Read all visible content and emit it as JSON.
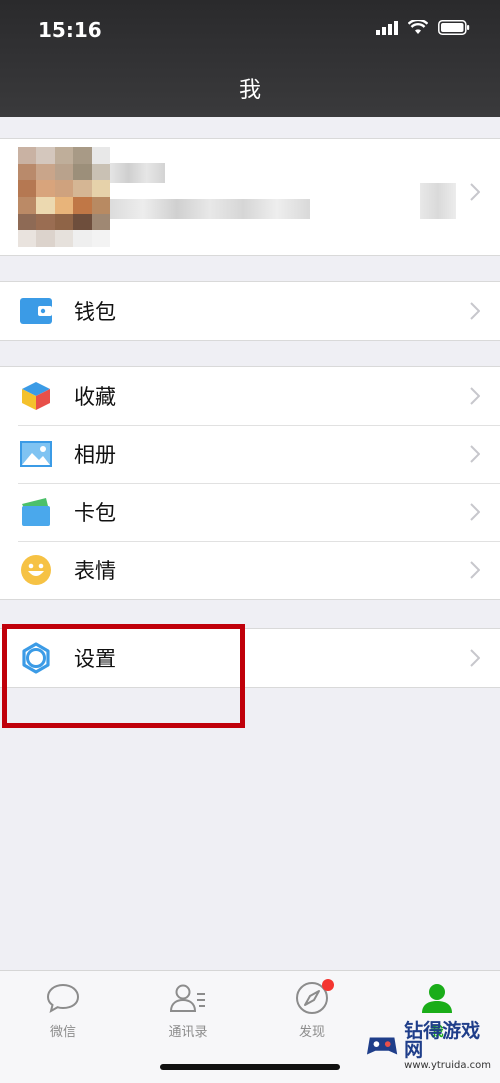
{
  "status_bar": {
    "time": "15:16"
  },
  "nav": {
    "title": "我"
  },
  "menu_groups": [
    {
      "items": [
        {
          "label": "钱包",
          "icon": "wallet-icon"
        }
      ]
    },
    {
      "items": [
        {
          "label": "收藏",
          "icon": "favorites-cube-icon"
        },
        {
          "label": "相册",
          "icon": "album-icon"
        },
        {
          "label": "卡包",
          "icon": "card-pack-icon"
        },
        {
          "label": "表情",
          "icon": "emoji-icon"
        }
      ]
    },
    {
      "items": [
        {
          "label": "设置",
          "icon": "gear-icon"
        }
      ]
    }
  ],
  "tabs": [
    {
      "label": "微信",
      "icon": "chat-bubble-icon",
      "active": false
    },
    {
      "label": "通讯录",
      "icon": "contacts-icon",
      "active": false
    },
    {
      "label": "发现",
      "icon": "compass-icon",
      "active": false,
      "badge": true
    },
    {
      "label": "我",
      "icon": "person-icon",
      "active": true
    }
  ],
  "colors": {
    "accent": "#1aad19",
    "highlight": "#c0000a",
    "badge": "#f43530",
    "icon_blue": "#3b9be6"
  },
  "watermark": {
    "text": "钻得游戏网",
    "sub": "www.ytruida.com"
  }
}
